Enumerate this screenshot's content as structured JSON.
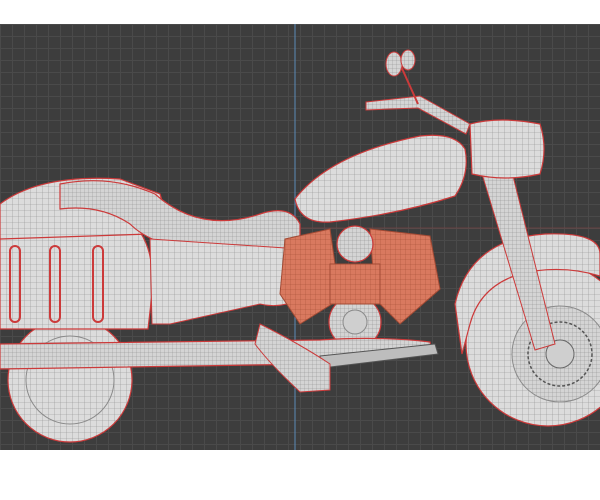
{
  "viewport": {
    "background": "#3d3d3d",
    "grid_color": "#4a4a4a",
    "axis_line_color": "#5a8ab8",
    "model": {
      "subject": "motorcycle",
      "display_mode": "wireframe",
      "surface_color": "#d8d8d8",
      "wire_color": "#8a8a8a",
      "seam_color": "#cc3a3a",
      "engine_color": "#d9795f"
    }
  },
  "colors": {
    "page_background": "#ffffff"
  }
}
